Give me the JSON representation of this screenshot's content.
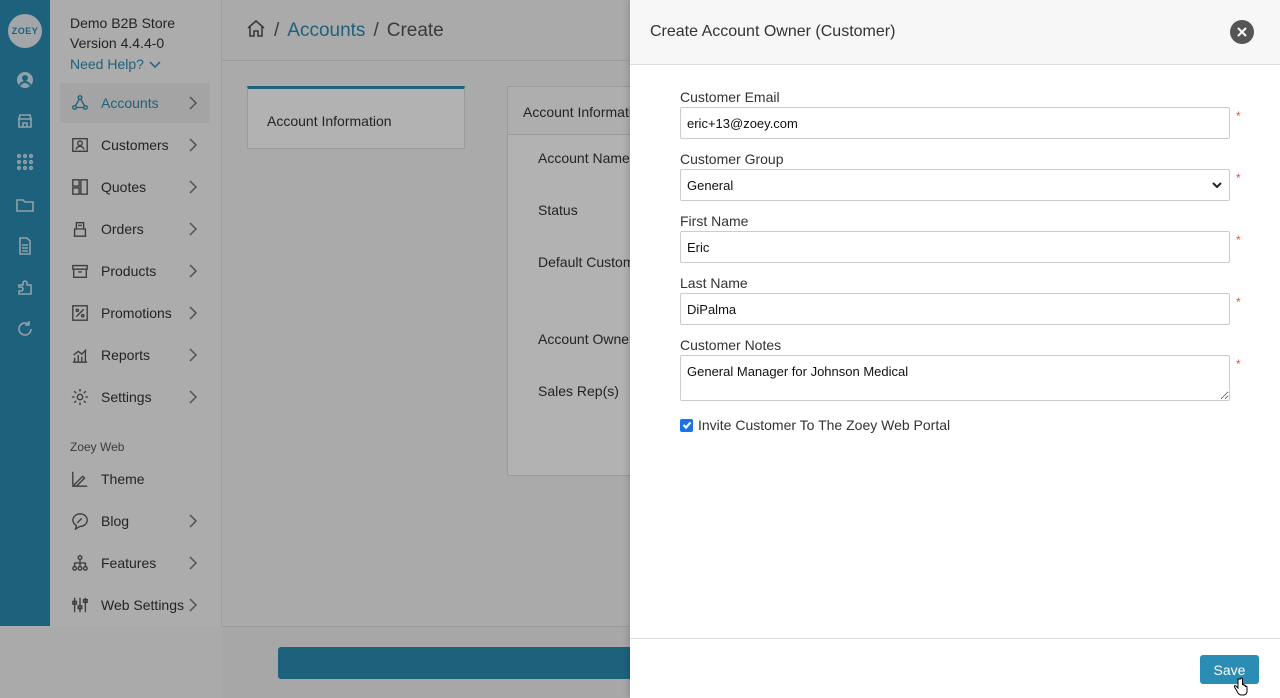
{
  "rail": {
    "logo": "ZOEY",
    "icons": [
      "user-circle-icon",
      "storefront-icon",
      "apps-grid-icon",
      "folder-icon",
      "document-icon",
      "puzzle-icon",
      "refresh-icon"
    ]
  },
  "sidebar": {
    "store_name": "Demo B2B Store",
    "version": "Version 4.4.4-0",
    "need_help": "Need Help?",
    "items": [
      {
        "label": "Accounts",
        "icon": "accounts-icon",
        "active": true
      },
      {
        "label": "Customers",
        "icon": "customers-icon"
      },
      {
        "label": "Quotes",
        "icon": "quotes-icon"
      },
      {
        "label": "Orders",
        "icon": "orders-icon"
      },
      {
        "label": "Products",
        "icon": "products-icon"
      },
      {
        "label": "Promotions",
        "icon": "promotions-icon"
      },
      {
        "label": "Reports",
        "icon": "reports-icon"
      },
      {
        "label": "Settings",
        "icon": "settings-icon"
      }
    ],
    "section_label": "Zoey Web",
    "web_items": [
      {
        "label": "Theme",
        "icon": "theme-icon"
      },
      {
        "label": "Blog",
        "icon": "blog-icon"
      },
      {
        "label": "Features",
        "icon": "features-icon"
      },
      {
        "label": "Web Settings",
        "icon": "web-settings-icon"
      }
    ]
  },
  "breadcrumb": {
    "sep": "/",
    "accounts": "Accounts",
    "current": "Create"
  },
  "page": {
    "tab_label": "Account Information",
    "card_header": "Account Information",
    "fields": [
      "Account Name",
      "Status",
      "Default Customer",
      "Account Owner",
      "Sales Rep(s)"
    ]
  },
  "modal": {
    "title": "Create Account Owner (Customer)",
    "email_label": "Customer Email",
    "email_value": "eric+13@zoey.com",
    "group_label": "Customer Group",
    "group_value": "General",
    "first_name_label": "First Name",
    "first_name_value": "Eric",
    "last_name_label": "Last Name",
    "last_name_value": "DiPalma",
    "notes_label": "Customer Notes",
    "notes_value": "General Manager for Johnson Medical",
    "required_mark": "*",
    "invite_label": "Invite Customer To The Zoey Web Portal",
    "invite_checked": true,
    "save_label": "Save"
  },
  "colors": {
    "accent": "#2b8cb4",
    "required": "#d9534f"
  }
}
